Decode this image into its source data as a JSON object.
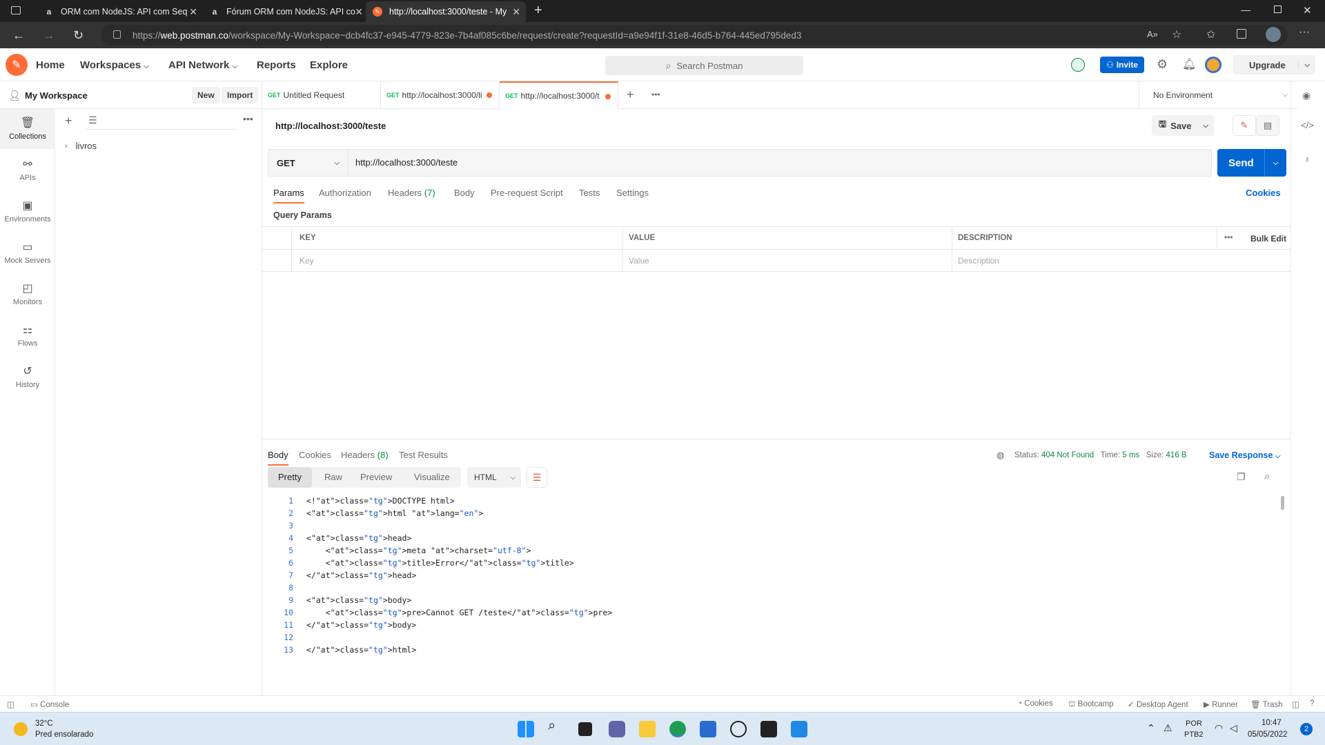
{
  "browser": {
    "tabs": [
      {
        "title": "ORM com NodeJS: API com Seq"
      },
      {
        "title": "Fórum ORM com NodeJS: API co"
      },
      {
        "title": "http://localhost:3000/teste - My"
      }
    ],
    "url_prefix": "https://",
    "url_domain": "web.postman.co",
    "url_rest": "/workspace/My-Workspace~dcb4fc37-e945-4779-823e-7b4af085c6be/request/create?requestId=a9e94f1f-31e8-46d5-b764-445ed795ded3"
  },
  "header": {
    "home": "Home",
    "workspaces": "Workspaces",
    "api_network": "API Network",
    "reports": "Reports",
    "explore": "Explore",
    "search_placeholder": "Search Postman",
    "invite": "Invite",
    "upgrade": "Upgrade"
  },
  "sidebar": {
    "workspace": "My Workspace",
    "new": "New",
    "import": "Import",
    "rail": [
      {
        "label": "Collections",
        "icon": "collections-icon"
      },
      {
        "label": "APIs",
        "icon": "apis-icon"
      },
      {
        "label": "Environments",
        "icon": "environments-icon"
      },
      {
        "label": "Mock Servers",
        "icon": "mock-servers-icon"
      },
      {
        "label": "Monitors",
        "icon": "monitors-icon"
      },
      {
        "label": "Flows",
        "icon": "flows-icon"
      },
      {
        "label": "History",
        "icon": "history-icon"
      }
    ],
    "collection": "livros"
  },
  "request_tabs": [
    {
      "method": "GET",
      "label": "Untitled Request"
    },
    {
      "method": "GET",
      "label": "http://localhost:3000/li"
    },
    {
      "method": "GET",
      "label": "http://localhost:3000/t"
    }
  ],
  "environment": "No Environment",
  "request": {
    "title": "http://localhost:3000/teste",
    "save": "Save",
    "method": "GET",
    "url": "http://localhost:3000/teste",
    "send": "Send",
    "subtabs": {
      "params": "Params",
      "authorization": "Authorization",
      "headers": "Headers",
      "headers_count": "(7)",
      "body": "Body",
      "prerequest": "Pre-request Script",
      "tests": "Tests",
      "settings": "Settings",
      "cookies": "Cookies"
    },
    "query_params_title": "Query Params",
    "table": {
      "key": "KEY",
      "value": "VALUE",
      "description": "DESCRIPTION",
      "bulk_edit": "Bulk Edit",
      "key_placeholder": "Key",
      "value_placeholder": "Value",
      "description_placeholder": "Description"
    }
  },
  "response": {
    "tabs": {
      "body": "Body",
      "cookies": "Cookies",
      "headers": "Headers",
      "headers_count": "(8)",
      "test_results": "Test Results"
    },
    "status_label": "Status:",
    "status_value": "404 Not Found",
    "time_label": "Time:",
    "time_value": "5 ms",
    "size_label": "Size:",
    "size_value": "416 B",
    "save_response": "Save Response",
    "views": {
      "pretty": "Pretty",
      "raw": "Raw",
      "preview": "Preview",
      "visualize": "Visualize"
    },
    "format": "HTML",
    "code": [
      "<!DOCTYPE html>",
      "<html lang=\"en\">",
      "",
      "<head>",
      "    <meta charset=\"utf-8\">",
      "    <title>Error</title>",
      "</head>",
      "",
      "<body>",
      "    <pre>Cannot GET /teste</pre>",
      "</body>",
      "",
      "</html>"
    ]
  },
  "statusbar": {
    "console": "Console",
    "cookies": "Cookies",
    "bootcamp": "Bootcamp",
    "desktop_agent": "Desktop Agent",
    "runner": "Runner",
    "trash": "Trash"
  },
  "taskbar": {
    "temp": "32°C",
    "weather": "Pred ensolarado",
    "lang1": "POR",
    "lang2": "PTB2",
    "time": "10:47",
    "date": "05/05/2022",
    "notif": "2"
  },
  "colors": {
    "accent": "#ff6c37",
    "send": "#0265d2",
    "invite": "#0265d2",
    "status_ok": "#0a8a3c"
  }
}
